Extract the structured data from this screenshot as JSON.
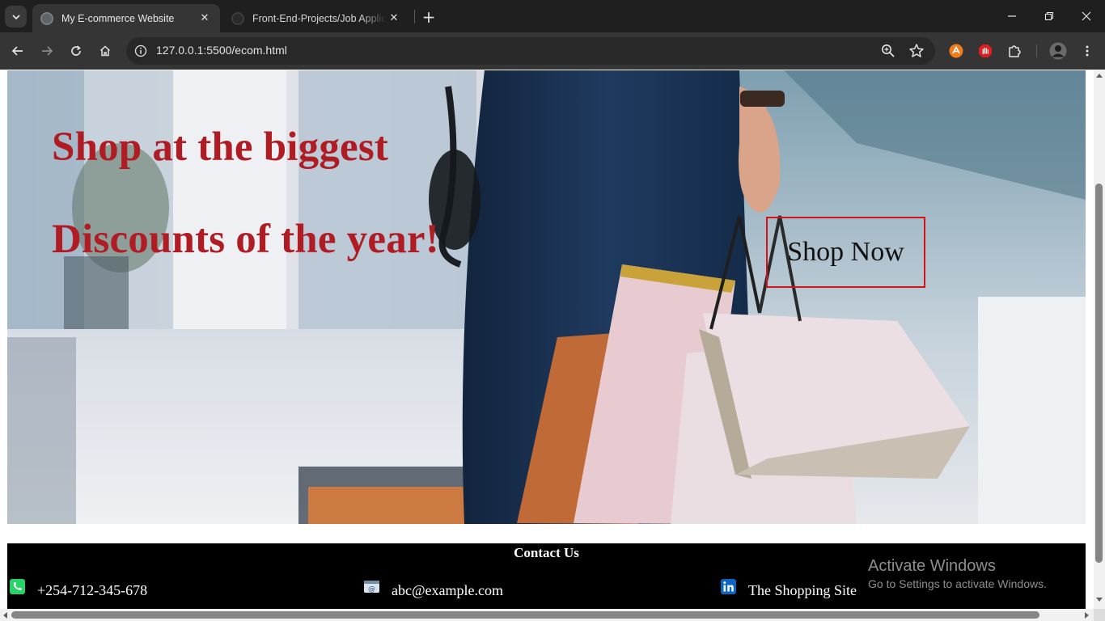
{
  "browser": {
    "tabs": [
      {
        "title": "My E-commerce Website",
        "active": true
      },
      {
        "title": "Front-End-Projects/Job Application",
        "active": false
      }
    ],
    "address": "127.0.0.1:5500/ecom.html",
    "icons": {
      "tab_list": "chevron-down-icon",
      "new_tab": "plus-icon",
      "back": "arrow-left-icon",
      "forward": "arrow-right-icon",
      "reload": "reload-icon",
      "home": "home-icon",
      "site_info": "info-icon",
      "zoom": "zoom-icon",
      "bookmark": "star-icon",
      "extensions": "puzzle-icon",
      "menu": "kebab-menu-icon"
    }
  },
  "hero": {
    "headline_line1": "Shop at the biggest",
    "headline_line2": "Discounts of the year!",
    "cta_label": "Shop Now",
    "headline_color": "#b01c24",
    "cta_border_color": "#d2131b"
  },
  "footer": {
    "heading": "Contact Us",
    "contacts": [
      {
        "icon": "phone-icon",
        "text": "+254-712-345-678"
      },
      {
        "icon": "email-icon",
        "text": "abc@example.com"
      },
      {
        "icon": "linkedin-icon",
        "text": "The Shopping Site"
      }
    ]
  },
  "watermark": {
    "title": "Activate Windows",
    "subtitle": "Go to Settings to activate Windows."
  },
  "scroll": {
    "vertical_position": 0.74,
    "vertical_visible_fraction": 0.73,
    "horizontal_position": 0.0,
    "horizontal_visible_fraction": 0.96
  }
}
